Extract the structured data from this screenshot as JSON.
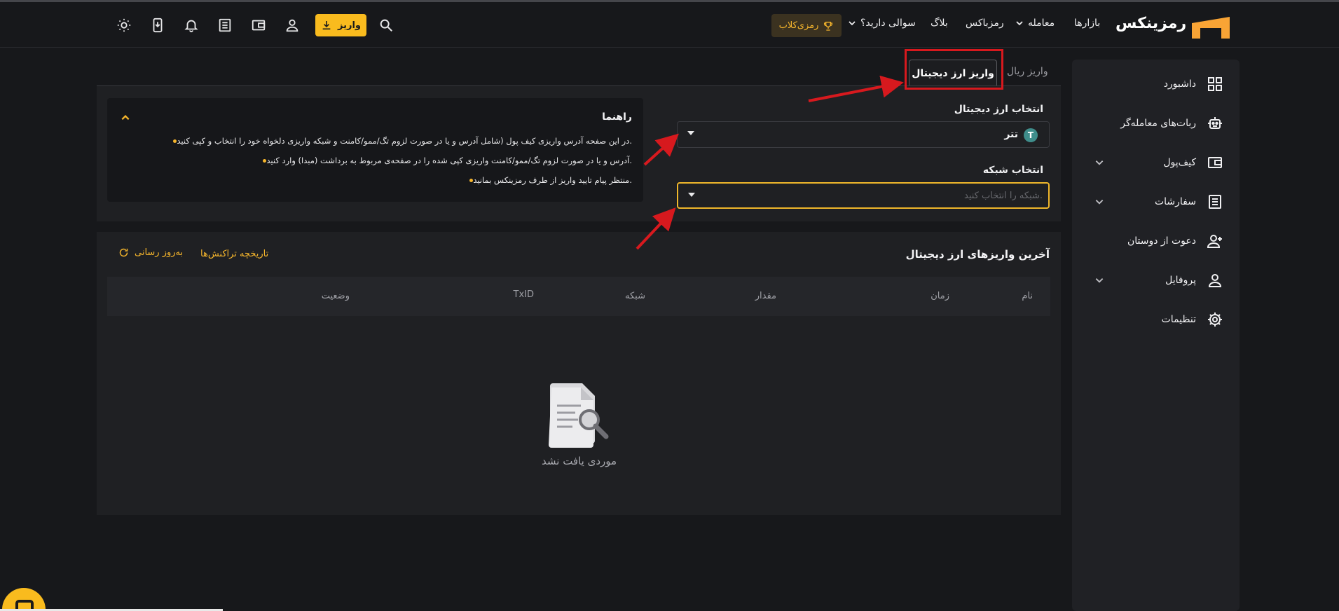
{
  "header": {
    "brand": "رمزینکس",
    "nav": {
      "markets": "بازارها",
      "trade": "معامله",
      "ramzibox": "رمزباکس",
      "blog": "بلاگ",
      "faq": "سوالی دارید؟"
    },
    "club_label": "رمزی‌کلاب",
    "deposit_label": "واریز"
  },
  "sidebar": {
    "items": [
      {
        "label": "داشبورد"
      },
      {
        "label": "ربات‌های معامله‌گر"
      },
      {
        "label": "کیف‌پول"
      },
      {
        "label": "سفارشات"
      },
      {
        "label": "دعوت از دوستان"
      },
      {
        "label": "پروفایل"
      },
      {
        "label": "تنظیمات"
      }
    ]
  },
  "tabs": {
    "rial": "واریز ریال",
    "crypto": "واریز ارز دیجیتال"
  },
  "form": {
    "currency_label": "انتخاب ارز دیجیتال",
    "currency_value": "تتر",
    "currency_badge": "T",
    "network_label": "انتخاب شبکه",
    "network_placeholder": "شبکه را انتخاب کنید."
  },
  "guide": {
    "title": "راهنما",
    "items": [
      "در این صفحه آدرس واریزی کیف پول (شامل آدرس و یا در صورت لزوم تگ/ممو/کامنت و شبکه واریزی دلخواه خود را انتخاب و کپی کنید.",
      "آدرس و یا در صورت لزوم تگ/ممو/کامنت واریزی کپی شده را در صفحه‌ی مربوط به برداشت (مبدا) وارد کنید.",
      "منتظر پیام تایید واریز از طرف رمزینکس بمانید."
    ]
  },
  "recent": {
    "title": "آخرین واریزهای ارز دیجیتال",
    "history_link": "تاریخچه تراکنش‌ها",
    "refresh_link": "به‌روز رسانی",
    "columns": [
      "نام",
      "زمان",
      "مقدار",
      "شبکه",
      "TxID",
      "وضعیت"
    ],
    "empty_text": "موردی یافت نشد"
  },
  "colors": {
    "accent": "#f9bb1e",
    "annotation": "#d7191e",
    "background": "#17181b",
    "panel": "#1f2023"
  }
}
